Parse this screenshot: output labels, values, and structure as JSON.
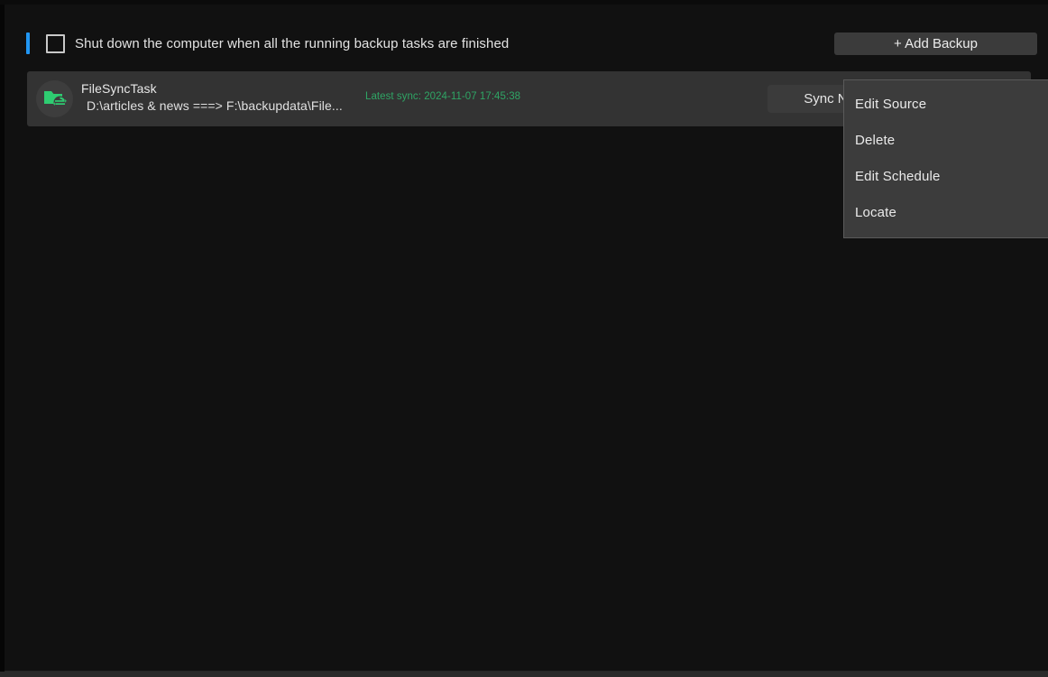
{
  "window": {
    "background_color": "#111111",
    "accent_color": "#2196f3"
  },
  "topbar": {
    "shutdown_checkbox": {
      "label": "Shut down the computer when all the running backup tasks are finished",
      "checked": false
    },
    "add_backup_label": "+ Add Backup"
  },
  "tasks": [
    {
      "name": "FileSyncTask",
      "path": "D:\\articles & news ===> F:\\backupdata\\File...",
      "latest_sync": "Latest sync: 2024-11-07 17:45:38",
      "latest_sync_color": "#2fa565",
      "action_label": "Sync Now",
      "icon": "folder-sync-icon"
    }
  ],
  "context_menu": {
    "visible": true,
    "items": [
      {
        "label": "Edit Source"
      },
      {
        "label": "Delete"
      },
      {
        "label": "Edit Schedule"
      },
      {
        "label": "Locate"
      }
    ]
  }
}
